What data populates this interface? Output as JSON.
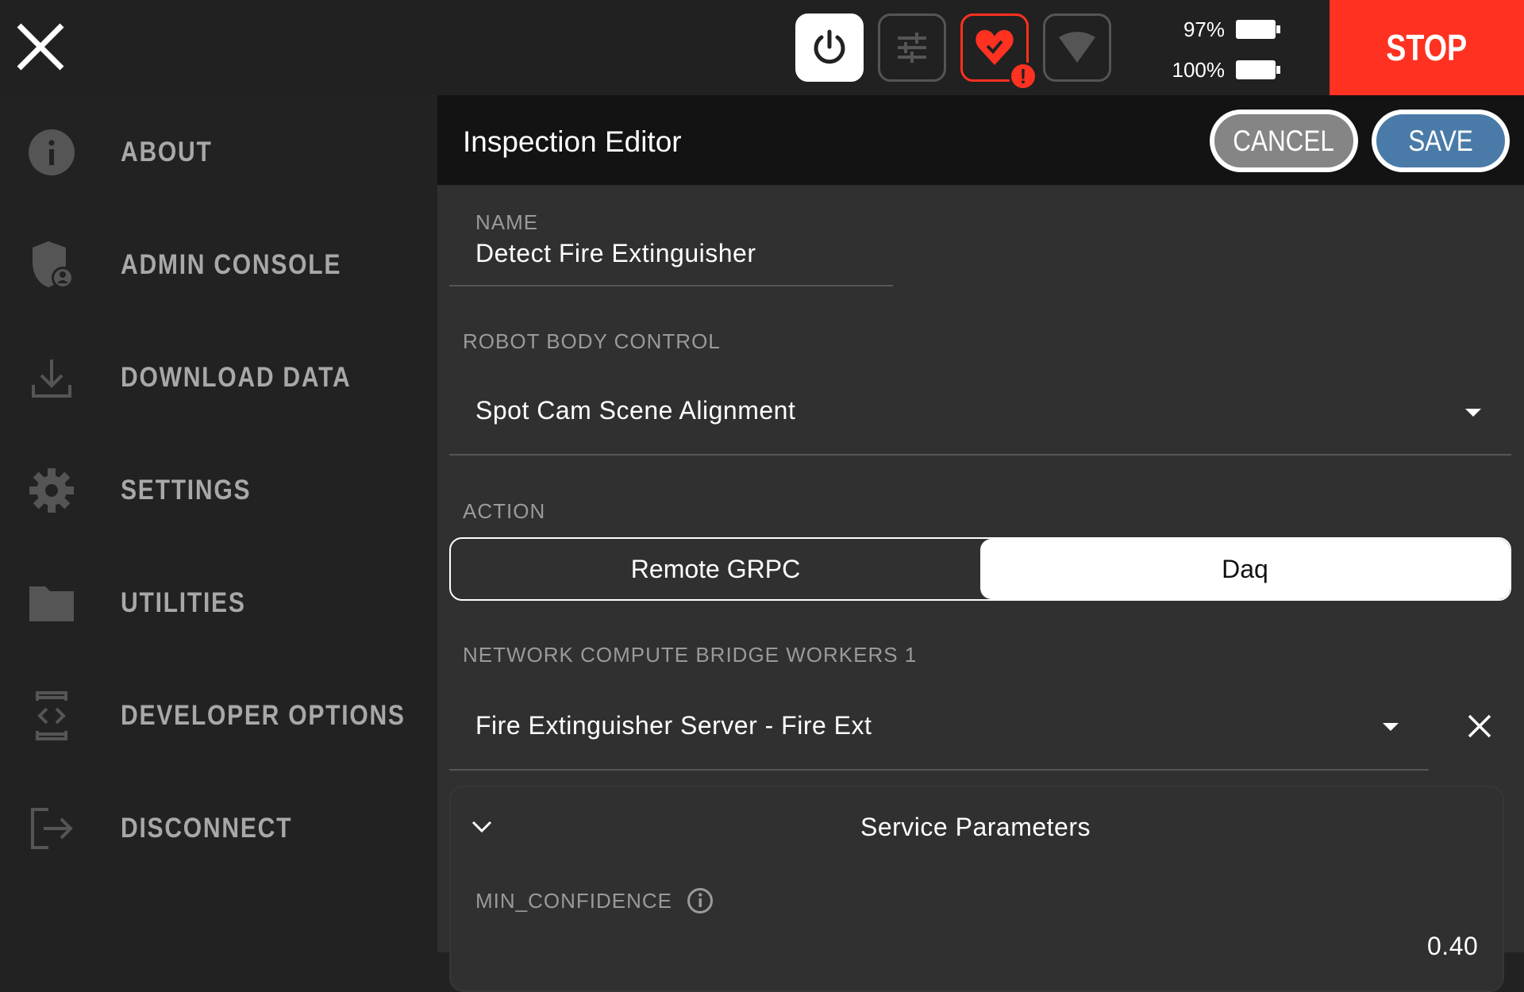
{
  "topbar": {
    "close_icon": "close-icon",
    "status_buttons": [
      "power-icon",
      "sliders-icon",
      "health-heart-icon",
      "wifi-signal-icon"
    ],
    "battery": [
      {
        "label": "97%",
        "level": 0.97
      },
      {
        "label": "100%",
        "level": 1.0
      }
    ],
    "stop_label": "STOP",
    "colors": {
      "stop": "#ff3120",
      "alert": "#ff3120",
      "save": "#4a7ba8"
    }
  },
  "sidebar": {
    "items": [
      {
        "label": "ABOUT",
        "icon": "info-icon"
      },
      {
        "label": "ADMIN CONSOLE",
        "icon": "admin-shield-icon"
      },
      {
        "label": "DOWNLOAD DATA",
        "icon": "download-icon"
      },
      {
        "label": "SETTINGS",
        "icon": "gear-icon"
      },
      {
        "label": "UTILITIES",
        "icon": "folder-icon"
      },
      {
        "label": "DEVELOPER OPTIONS",
        "icon": "developer-icon"
      },
      {
        "label": "DISCONNECT",
        "icon": "logout-icon"
      }
    ]
  },
  "editor": {
    "title": "Inspection Editor",
    "cancel_label": "CANCEL",
    "save_label": "SAVE",
    "name_label": "NAME",
    "name_value": "Detect Fire Extinguisher",
    "body_control_label": "ROBOT BODY CONTROL",
    "body_control_value": "Spot Cam Scene Alignment",
    "action_label": "ACTION",
    "action_options": [
      "Remote GRPC",
      "Daq"
    ],
    "action_selected": "Daq",
    "workers_label": "NETWORK COMPUTE BRIDGE WORKERS 1",
    "workers_value": "Fire Extinguisher Server - Fire Ext",
    "service_params_title": "Service Parameters",
    "min_confidence_label": "MIN_CONFIDENCE",
    "min_confidence_value": "0.40"
  }
}
